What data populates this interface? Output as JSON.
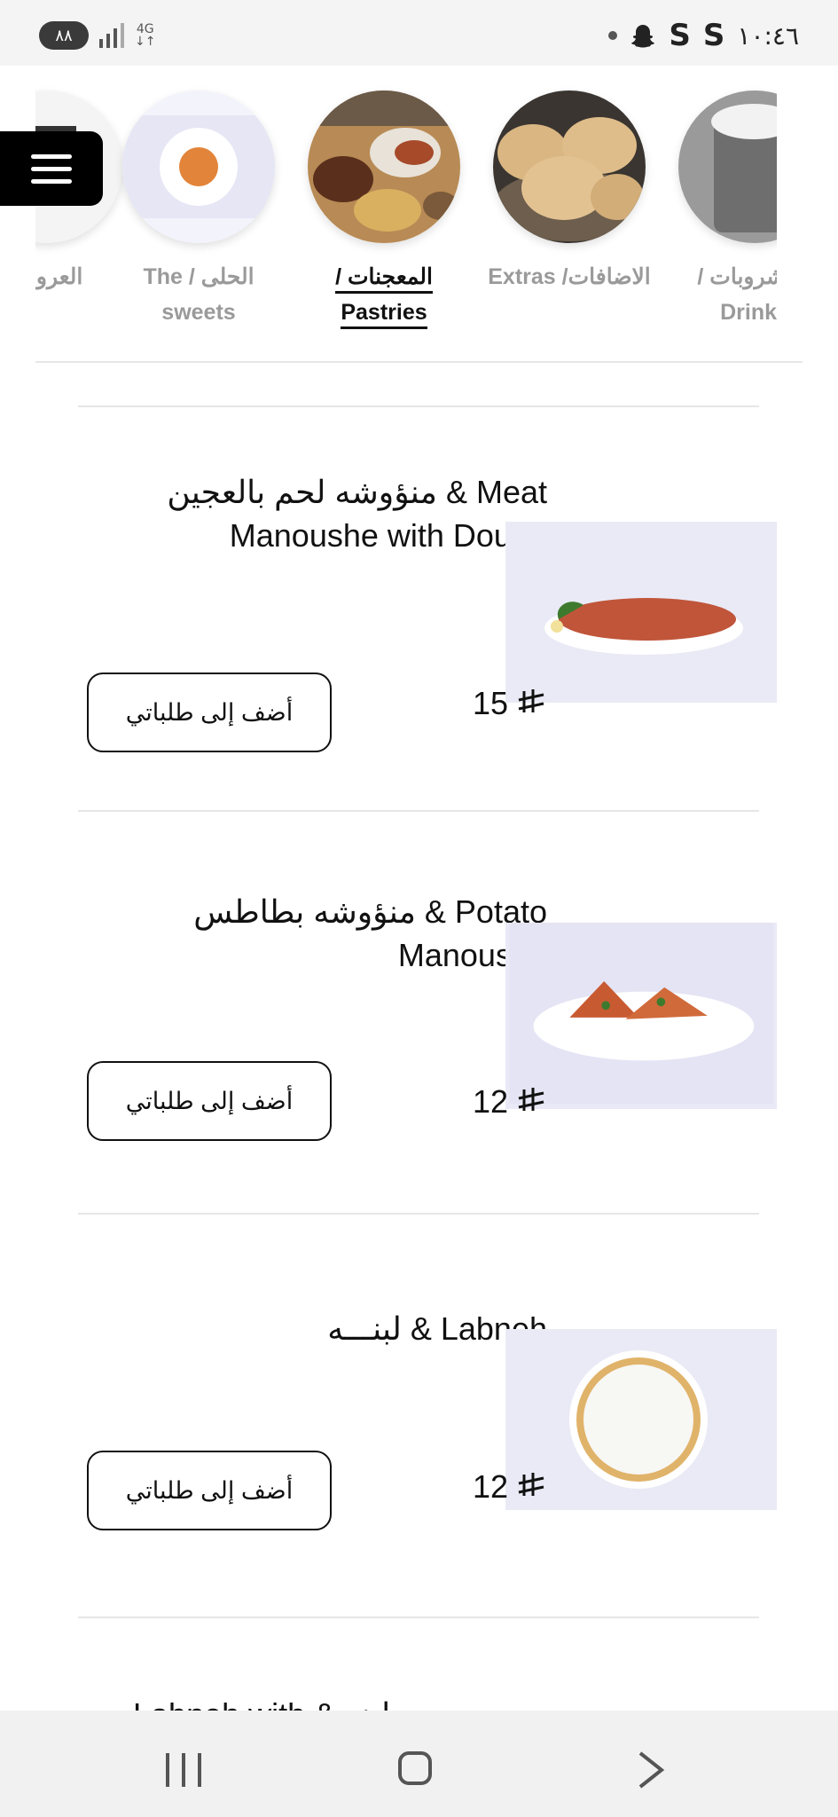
{
  "status_bar": {
    "time": "١٠:٤٦",
    "battery": "٨٨",
    "network": "4G",
    "apps": [
      "S",
      "S"
    ],
    "icons": [
      "snapchat-icon",
      "signal-icon",
      "dot-icon"
    ]
  },
  "categories": [
    {
      "label": "العروض",
      "image": "offers",
      "active": false
    },
    {
      "label": "الحلى / The sweets",
      "image": "sweets",
      "active": false
    },
    {
      "label": "المعجنات / Pastries",
      "image": "pastries",
      "active": true
    },
    {
      "label": "الاضافات/ Extras",
      "image": "extras",
      "active": false
    },
    {
      "label": "المشروبات / Drinks",
      "image": "drinks",
      "active": false
    }
  ],
  "menu_button": {
    "icon": "hamburger-menu-icon"
  },
  "products": [
    {
      "name": "منؤوشه لحم بالعجين & Meat Manoushe with Dough",
      "price": "15",
      "currency_icon": "saudi-riyal-icon",
      "button": "أضف إلى طلباتي",
      "image": "meat-manoushe"
    },
    {
      "name": "منؤوشه بطاطس & Potato Manoushe",
      "price": "12",
      "currency_icon": "saudi-riyal-icon",
      "button": "أضف إلى طلباتي",
      "image": "potato-manoushe"
    },
    {
      "name": "لبنـــه & Labneh",
      "price": "12",
      "currency_icon": "saudi-riyal-icon",
      "button": "أضف إلى طلباتي",
      "image": "labneh"
    }
  ],
  "partial_next_item": "Labneh with & لبنه",
  "nav_bar": {
    "icons": [
      "recent-apps-icon",
      "home-icon",
      "back-icon"
    ]
  }
}
